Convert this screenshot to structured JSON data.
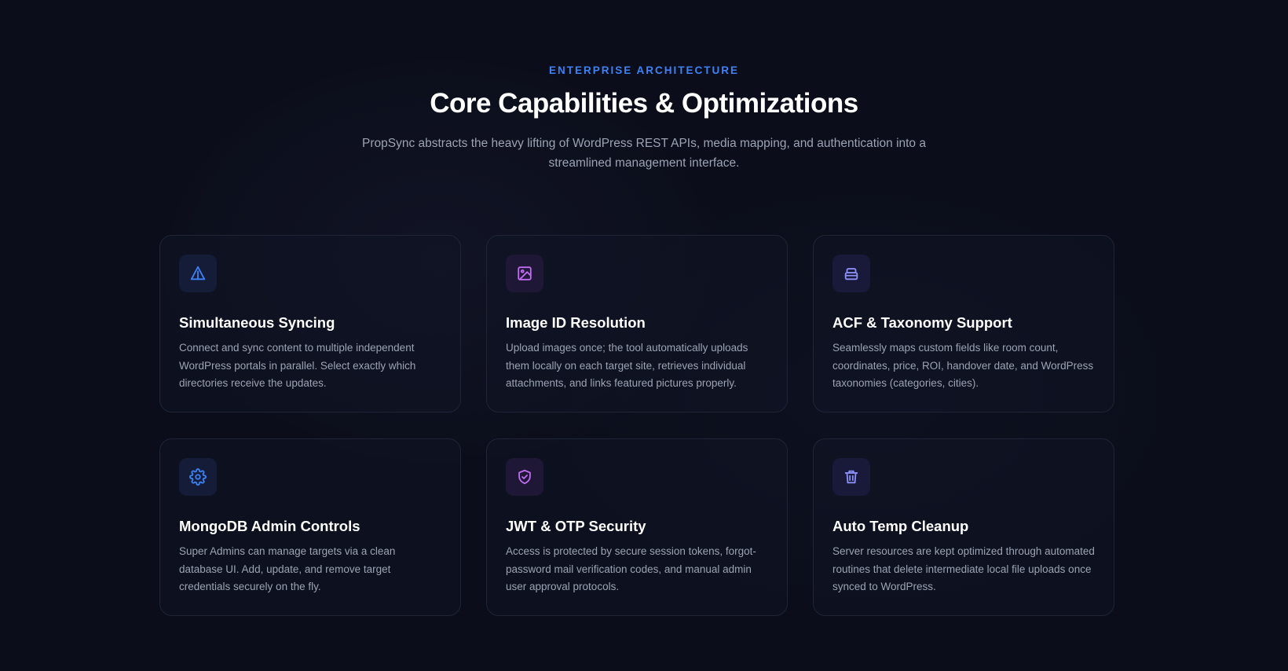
{
  "section": {
    "eyebrow": "ENTERPRISE ARCHITECTURE",
    "title": "Core Capabilities & Optimizations",
    "subtitle": "PropSync abstracts the heavy lifting of WordPress REST APIs, media mapping, and authentication into a streamlined management interface."
  },
  "colors": {
    "background": "#0b0e1a",
    "accent_blue": "#3b82f6",
    "accent_purple": "#c06bf0",
    "accent_indigo": "#8b8ff5",
    "card_border": "#1f2537",
    "muted_text": "#9ca3b4"
  },
  "features": [
    {
      "icon": "navigation-triangle-icon",
      "title": "Simultaneous Syncing",
      "description": "Connect and sync content to multiple independent WordPress portals in parallel. Select exactly which directories receive the updates."
    },
    {
      "icon": "image-icon",
      "title": "Image ID Resolution",
      "description": "Upload images once; the tool automatically uploads them locally on each target site, retrieves individual attachments, and links featured pictures properly."
    },
    {
      "icon": "archive-stack-icon",
      "title": "ACF & Taxonomy Support",
      "description": "Seamlessly maps custom fields like room count, coordinates, price, ROI, handover date, and WordPress taxonomies (categories, cities)."
    },
    {
      "icon": "gear-icon",
      "title": "MongoDB Admin Controls",
      "description": "Super Admins can manage targets via a clean database UI. Add, update, and remove target credentials securely on the fly."
    },
    {
      "icon": "shield-check-icon",
      "title": "JWT & OTP Security",
      "description": "Access is protected by secure session tokens, forgot-password mail verification codes, and manual admin user approval protocols."
    },
    {
      "icon": "trash-icon",
      "title": "Auto Temp Cleanup",
      "description": "Server resources are kept optimized through automated routines that delete intermediate local file uploads once synced to WordPress."
    }
  ]
}
